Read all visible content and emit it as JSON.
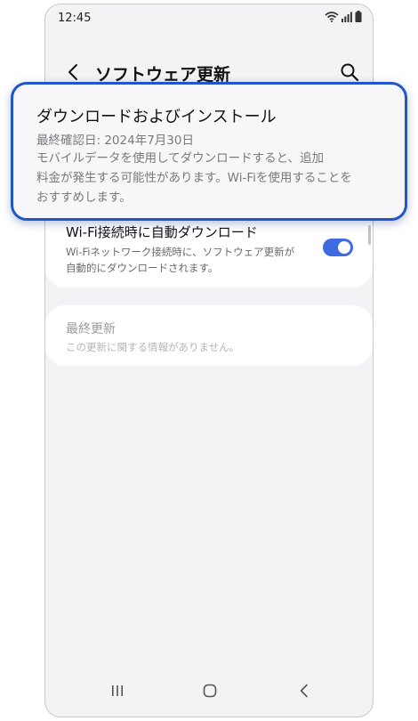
{
  "status_bar": {
    "time": "12:45"
  },
  "app_bar": {
    "title": "ソフトウェア更新"
  },
  "download_card": {
    "title": "ダウンロードおよびインストール",
    "last_checked": "最終確認日: 2024年7月30日",
    "description_line1": "モバイルデータを使用してダウンロードすると、追加",
    "description_line2": "料金が発生する可能性があります。Wi-Fiを使用することを",
    "description_line3": "おすすめします。"
  },
  "auto_download": {
    "title": "Wi-Fi接続時に自動ダウンロード",
    "description_line1": "Wi-Fiネットワーク接続時に、ソフトウェア更新が",
    "description_line2": "自動的にダウンロードされます。",
    "enabled": true
  },
  "last_update": {
    "title": "最終更新",
    "description": "この更新に関する情報がありません。"
  },
  "colors": {
    "accent": "#3e6be0",
    "highlight_border": "#1f56c8",
    "background": "#f3f3f5"
  },
  "icons": {
    "back": "chevron-left-icon",
    "search": "search-icon",
    "nav_recents": "recents-icon",
    "nav_home": "home-icon",
    "nav_back": "nav-back-icon"
  }
}
